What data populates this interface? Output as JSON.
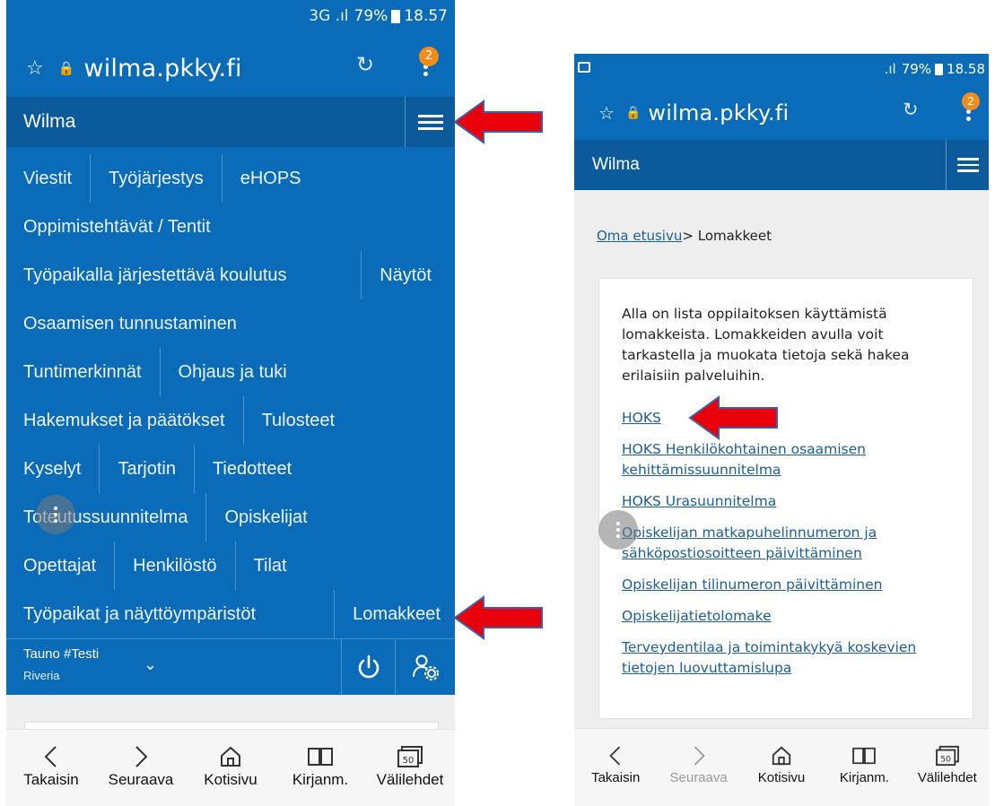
{
  "left": {
    "status": {
      "network": "3G .ıl",
      "battery": "79%",
      "time": "18.57"
    },
    "url": {
      "domain": "wilma.pkky.fi",
      "badge": "2"
    },
    "app_title": "Wilma",
    "nav_rows": [
      [
        "Viestit",
        "Työjärjestys",
        "eHOPS"
      ],
      [
        "Oppimistehtävät / Tentit"
      ],
      [
        "Työpaikalla järjestettävä koulutus",
        "Näytöt"
      ],
      [
        "Osaamisen tunnustaminen"
      ],
      [
        "Tuntimerkinnät",
        "Ohjaus ja tuki"
      ],
      [
        "Hakemukset ja päätökset",
        "Tulosteet"
      ],
      [
        "Kyselyt",
        "Tarjotin",
        "Tiedotteet"
      ],
      [
        "Toteutussuunnitelma",
        "Opiskelijat"
      ],
      [
        "Opettajat",
        "Henkilöstö",
        "Tilat"
      ],
      [
        "Työpaikat ja näyttöympäristöt",
        "Lomakkeet"
      ]
    ],
    "user": {
      "name": "Tauno #Testi",
      "org": "Riveria"
    }
  },
  "right": {
    "status": {
      "network": ".ıl",
      "battery": "79%",
      "time": "18.58"
    },
    "url": {
      "domain": "wilma.pkky.fi",
      "badge": "2"
    },
    "app_title": "Wilma",
    "breadcrumb": {
      "home": "Oma etusivu",
      "sep": ">",
      "current": "Lomakkeet"
    },
    "intro": "Alla on lista oppilaitoksen käyttämistä lomakkeista. Lomakkeiden avulla voit tarkastella ja muokata tietoja sekä hakea erilaisiin palveluihin.",
    "links": [
      "HOKS",
      "HOKS Henkilökohtainen osaamisen kehittämissuunnitelma",
      "HOKS Urasuunnitelma",
      "Opiskelijan matkapuhelinnumeron ja sähköpostiosoitteen päivittäminen",
      "Opiskelijan tilinumeron päivittäminen",
      "Opiskelijatietolomake",
      "Terveydentilaa ja toimintakykyä koskevien tietojen luovuttamislupa"
    ]
  },
  "bottom_bar": {
    "back": "Takaisin",
    "forward": "Seuraava",
    "home": "Kotisivu",
    "bookmarks": "Kirjanm.",
    "tabs": "Välilehdet",
    "tabs_count": "50"
  },
  "colors": {
    "wilma_blue": "#0a6bb8",
    "wilma_dark": "#0a5a9c",
    "arrow_red": "#e8000b",
    "link": "#1b5e96"
  }
}
